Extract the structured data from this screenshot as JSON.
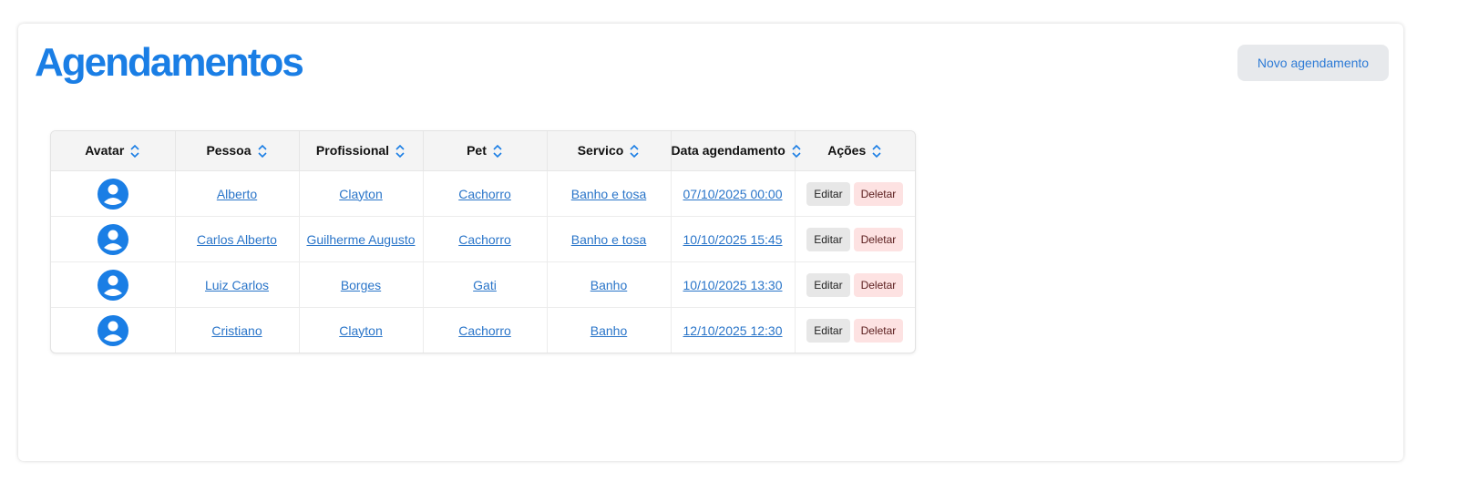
{
  "page": {
    "title": "Agendamentos",
    "new_button_label": "Novo agendamento"
  },
  "colors": {
    "accent": "#1a7ee5",
    "link": "#2a75c9",
    "delete_bg": "#fde2e2"
  },
  "table": {
    "sort_icon": "chevron-up-down-icon",
    "avatar_icon": "user-circle-icon",
    "headers": [
      "Avatar",
      "Pessoa",
      "Profissional",
      "Pet",
      "Servico",
      "Data agendamento",
      "Ações"
    ],
    "edit_label": "Editar",
    "delete_label": "Deletar",
    "rows": [
      {
        "pessoa": "Alberto",
        "profissional": "Clayton",
        "pet": "Cachorro",
        "servico": "Banho e tosa",
        "data": "07/10/2025 00:00"
      },
      {
        "pessoa": "Carlos Alberto",
        "profissional": "Guilherme Augusto",
        "pet": "Cachorro",
        "servico": "Banho e tosa",
        "data": "10/10/2025 15:45"
      },
      {
        "pessoa": "Luiz Carlos",
        "profissional": "Borges",
        "pet": "Gati",
        "servico": "Banho",
        "data": "10/10/2025 13:30"
      },
      {
        "pessoa": "Cristiano",
        "profissional": "Clayton",
        "pet": "Cachorro",
        "servico": "Banho",
        "data": "12/10/2025 12:30"
      }
    ]
  }
}
